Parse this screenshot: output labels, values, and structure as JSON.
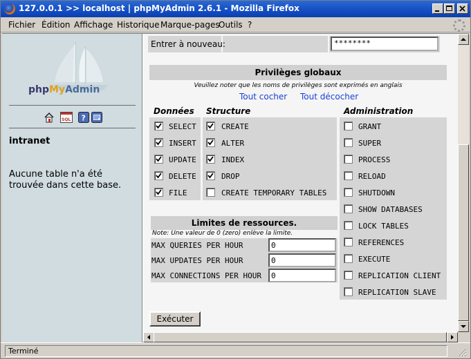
{
  "window": {
    "title": "127.0.0.1 >> localhost | phpMyAdmin 2.6.1 - Mozilla Firefox"
  },
  "menu": [
    {
      "label": "Fichier"
    },
    {
      "label": "Édition"
    },
    {
      "label": "Affichage"
    },
    {
      "label": "Historique"
    },
    {
      "label": "Marque-pages"
    },
    {
      "label": "Outils"
    },
    {
      "label": "?"
    }
  ],
  "left": {
    "logo": {
      "php": "php",
      "my": "My",
      "admin": "Admin"
    },
    "icons": [
      "home-icon",
      "sql-icon",
      "help-icon",
      "docs-icon"
    ],
    "db_name": "intranet",
    "no_table_msg": "Aucune table n'a été trouvée dans cette base."
  },
  "password": {
    "label": "Entrer à nouveau:",
    "value": "********"
  },
  "privileges": {
    "title": "Privilèges globaux",
    "note": "Veuillez noter que les noms de privilèges sont exprimés en anglais",
    "check_all": "Tout cocher",
    "uncheck_all": "Tout décocher",
    "groups": {
      "data": {
        "label": "Données",
        "items": [
          {
            "name": "SELECT",
            "checked": true
          },
          {
            "name": "INSERT",
            "checked": true
          },
          {
            "name": "UPDATE",
            "checked": true
          },
          {
            "name": "DELETE",
            "checked": true
          },
          {
            "name": "FILE",
            "checked": true
          }
        ]
      },
      "structure": {
        "label": "Structure",
        "items": [
          {
            "name": "CREATE",
            "checked": true
          },
          {
            "name": "ALTER",
            "checked": true
          },
          {
            "name": "INDEX",
            "checked": true
          },
          {
            "name": "DROP",
            "checked": true
          },
          {
            "name": "CREATE TEMPORARY TABLES",
            "checked": false
          }
        ]
      },
      "admin": {
        "label": "Administration",
        "items": [
          {
            "name": "GRANT",
            "checked": false
          },
          {
            "name": "SUPER",
            "checked": false
          },
          {
            "name": "PROCESS",
            "checked": false
          },
          {
            "name": "RELOAD",
            "checked": false
          },
          {
            "name": "SHUTDOWN",
            "checked": false
          },
          {
            "name": "SHOW DATABASES",
            "checked": false
          },
          {
            "name": "LOCK TABLES",
            "checked": false
          },
          {
            "name": "REFERENCES",
            "checked": false
          },
          {
            "name": "EXECUTE",
            "checked": false
          },
          {
            "name": "REPLICATION CLIENT",
            "checked": false
          },
          {
            "name": "REPLICATION SLAVE",
            "checked": false
          }
        ]
      }
    }
  },
  "limits": {
    "title": "Limites de ressources.",
    "note": "Note: Une valeur de 0 (zero) enlève la limite.",
    "rows": [
      {
        "label": "MAX QUERIES PER HOUR",
        "value": "0"
      },
      {
        "label": "MAX UPDATES PER HOUR",
        "value": "0"
      },
      {
        "label": "MAX CONNECTIONS PER HOUR",
        "value": "0"
      }
    ]
  },
  "execute_label": "Exécuter",
  "status": "Terminé"
}
